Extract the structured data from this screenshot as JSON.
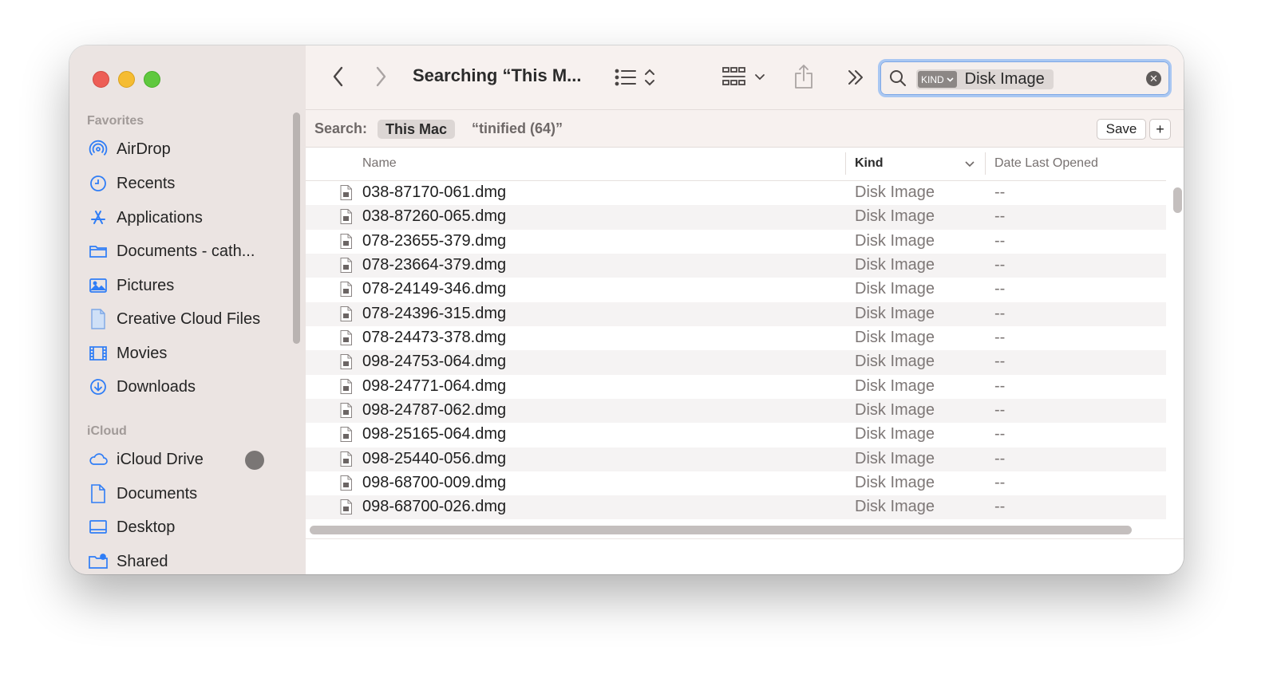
{
  "window": {
    "title": "Searching “This M..."
  },
  "sidebar": {
    "favorites_header": "Favorites",
    "favorites": [
      {
        "label": "AirDrop",
        "icon": "airdrop-icon"
      },
      {
        "label": "Recents",
        "icon": "clock-icon"
      },
      {
        "label": "Applications",
        "icon": "applications-icon"
      },
      {
        "label": "Documents - cath...",
        "icon": "folder-icon"
      },
      {
        "label": "Pictures",
        "icon": "pictures-icon"
      },
      {
        "label": "Creative Cloud Files",
        "icon": "document-icon"
      },
      {
        "label": "Movies",
        "icon": "film-icon"
      },
      {
        "label": "Downloads",
        "icon": "download-icon"
      }
    ],
    "icloud_header": "iCloud",
    "icloud": [
      {
        "label": "iCloud Drive",
        "icon": "cloud-icon"
      },
      {
        "label": "Documents",
        "icon": "document-icon"
      },
      {
        "label": "Desktop",
        "icon": "desktop-icon"
      },
      {
        "label": "Shared",
        "icon": "shared-folder-icon"
      }
    ]
  },
  "search": {
    "token_kind": "KIND",
    "token_value": "Disk Image",
    "clear_glyph": "✕"
  },
  "scope": {
    "label": "Search:",
    "this_mac": "This Mac",
    "other": "“tinified (64)”",
    "save": "Save",
    "plus": "+"
  },
  "columns": {
    "name": "Name",
    "kind": "Kind",
    "date": "Date Last Opened"
  },
  "files": [
    {
      "name": "038-87170-061.dmg",
      "kind": "Disk Image",
      "date": "--"
    },
    {
      "name": "038-87260-065.dmg",
      "kind": "Disk Image",
      "date": "--"
    },
    {
      "name": "078-23655-379.dmg",
      "kind": "Disk Image",
      "date": "--"
    },
    {
      "name": "078-23664-379.dmg",
      "kind": "Disk Image",
      "date": "--"
    },
    {
      "name": "078-24149-346.dmg",
      "kind": "Disk Image",
      "date": "--"
    },
    {
      "name": "078-24396-315.dmg",
      "kind": "Disk Image",
      "date": "--"
    },
    {
      "name": "078-24473-378.dmg",
      "kind": "Disk Image",
      "date": "--"
    },
    {
      "name": "098-24753-064.dmg",
      "kind": "Disk Image",
      "date": "--"
    },
    {
      "name": "098-24771-064.dmg",
      "kind": "Disk Image",
      "date": "--"
    },
    {
      "name": "098-24787-062.dmg",
      "kind": "Disk Image",
      "date": "--"
    },
    {
      "name": "098-25165-064.dmg",
      "kind": "Disk Image",
      "date": "--"
    },
    {
      "name": "098-25440-056.dmg",
      "kind": "Disk Image",
      "date": "--"
    },
    {
      "name": "098-68700-009.dmg",
      "kind": "Disk Image",
      "date": "--"
    },
    {
      "name": "098-68700-026.dmg",
      "kind": "Disk Image",
      "date": "--"
    }
  ],
  "colors": {
    "accent": "#2f7df6",
    "close": "#ed5e56",
    "minimize": "#f5bc32",
    "zoom": "#5fc83e",
    "sidebar_bg": "#ebe4e2"
  }
}
